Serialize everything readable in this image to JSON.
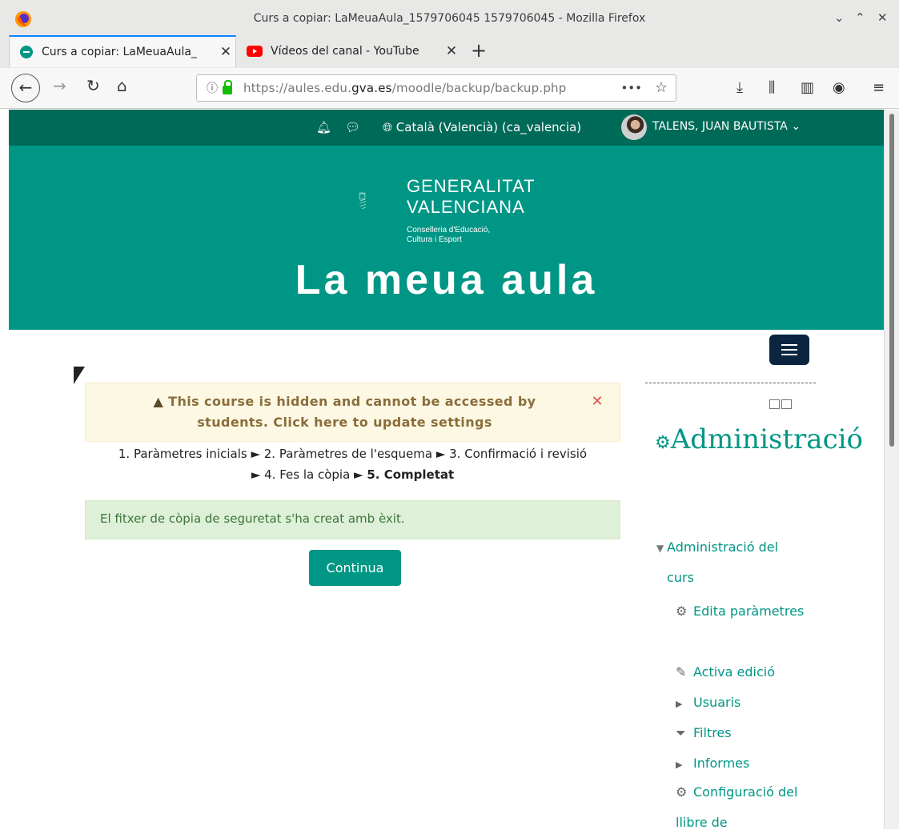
{
  "window": {
    "title": "Curs a copiar: LaMeuaAula_1579706045 1579706045 - Mozilla Firefox"
  },
  "tabs": [
    {
      "label": "Curs a copiar: LaMeuaAula_"
    },
    {
      "label": "Vídeos del canal - YouTube"
    }
  ],
  "urlbar": {
    "url_pre": "https://aules.edu.",
    "url_domain": "gva.es",
    "url_post": "/moodle/backup/backup.php"
  },
  "topnav": {
    "language": "Català (Valencià) (ca_valencia)",
    "user": "TALENS, JUAN BAUTISTA"
  },
  "banner": {
    "org_line1": "GENERALITAT",
    "org_line2": "VALENCIANA",
    "dept_line1": "Conselleria d'Educació,",
    "dept_line2": "Cultura i Esport",
    "site_title": "La meua aula"
  },
  "main": {
    "warning": "This course is hidden and cannot be accessed by students. Click here to update settings",
    "steps_line1": "1. Paràmetres inicials ► 2. Paràmetres de l'esquema ► 3. Confirmació i revisió",
    "steps_line2a": "► 4. Fes la còpia ► ",
    "steps_line2b": "5. Completat",
    "success": "El fitxer de còpia de seguretat s'ha creat amb èxit.",
    "continue_label": "Continua"
  },
  "sidebar": {
    "title": "Administració",
    "items": [
      {
        "label": "Administració del curs"
      },
      {
        "label": "Edita paràmetres"
      },
      {
        "label": "Activa edició"
      },
      {
        "label": "Usuaris"
      },
      {
        "label": "Filtres"
      },
      {
        "label": "Informes"
      },
      {
        "label": "Configuració del llibre de"
      }
    ]
  }
}
